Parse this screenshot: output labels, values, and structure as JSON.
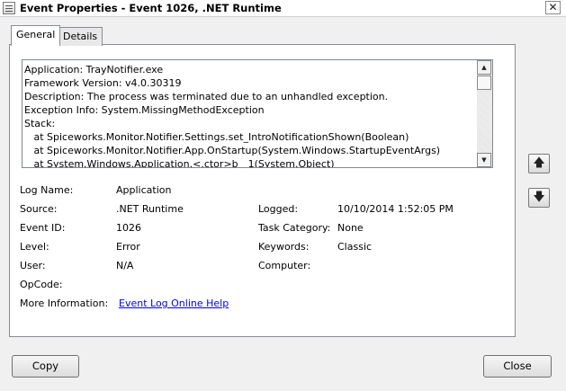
{
  "window": {
    "title": "Event Properties - Event 1026, .NET Runtime",
    "close_glyph": "✕"
  },
  "tabs": [
    {
      "label": "General",
      "active": true
    },
    {
      "label": "Details",
      "active": false
    }
  ],
  "description_lines": [
    "Application: TrayNotifier.exe",
    "Framework Version: v4.0.30319",
    "Description: The process was terminated due to an unhandled exception.",
    "Exception Info: System.MissingMethodException",
    "Stack:",
    "   at Spiceworks.Monitor.Notifier.Settings.set_IntroNotificationShown(Boolean)",
    "   at Spiceworks.Monitor.Notifier.App.OnStartup(System.Windows.StartupEventArgs)",
    "   at System.Windows.Application.<.ctor>b__1(System.Object)"
  ],
  "fields": {
    "log_name": {
      "label": "Log Name:",
      "value": "Application"
    },
    "source": {
      "label": "Source:",
      "value": ".NET Runtime"
    },
    "logged": {
      "label": "Logged:",
      "value": "10/10/2014 1:52:05 PM"
    },
    "event_id": {
      "label": "Event ID:",
      "value": "1026"
    },
    "task_category": {
      "label": "Task Category:",
      "value": "None"
    },
    "level": {
      "label": "Level:",
      "value": "Error"
    },
    "keywords": {
      "label": "Keywords:",
      "value": "Classic"
    },
    "user": {
      "label": "User:",
      "value": "N/A"
    },
    "computer": {
      "label": "Computer:",
      "value": ""
    },
    "opcode": {
      "label": "OpCode:",
      "value": ""
    },
    "more_info": {
      "label": "More Information:",
      "link": "Event Log Online Help"
    }
  },
  "side_buttons": {
    "up_glyph": "🡅",
    "down_glyph": "🡇"
  },
  "buttons": {
    "copy": "Copy",
    "close": "Close"
  },
  "colors": {
    "link": "#0000ee",
    "panel_border": "#898c95"
  }
}
